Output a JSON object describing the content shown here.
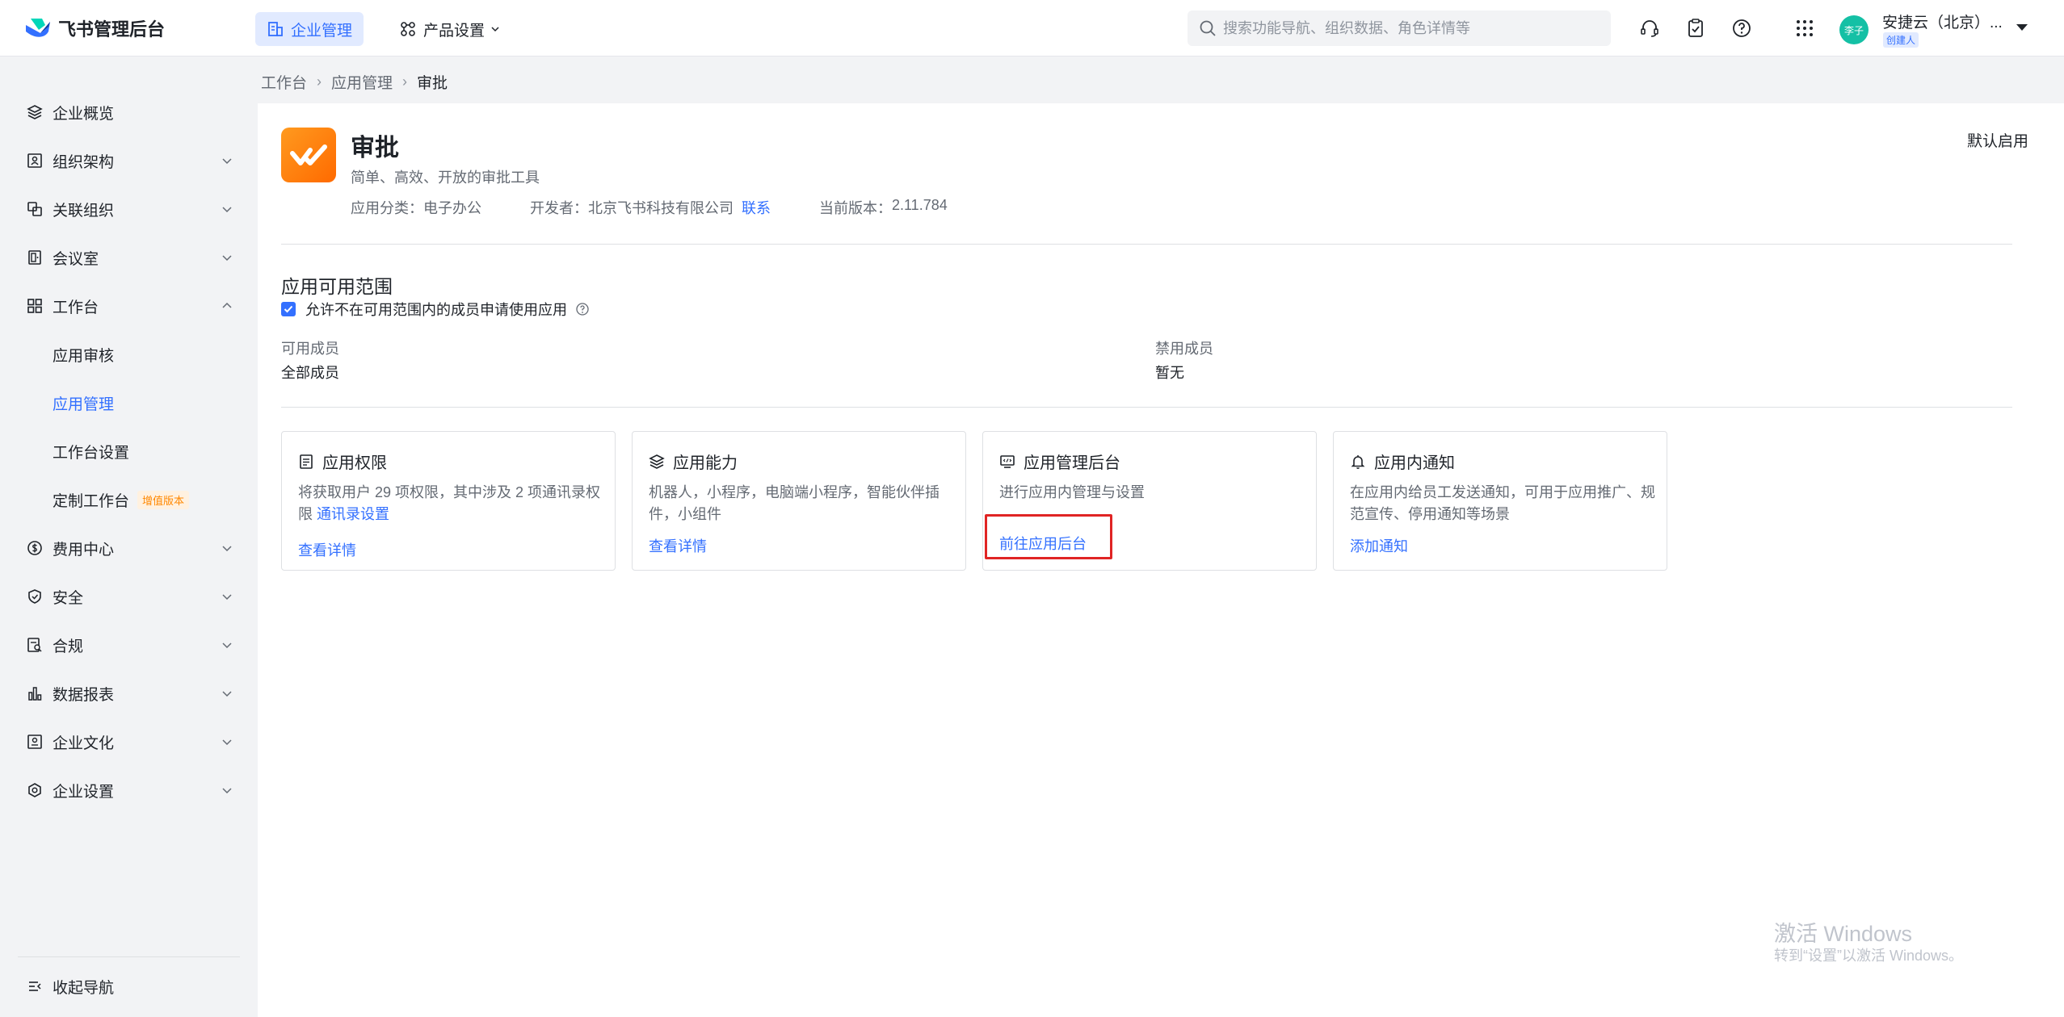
{
  "topbar": {
    "logo_text": "飞书管理后台",
    "nav": [
      {
        "label": "企业管理",
        "active": true
      },
      {
        "label": "产品设置",
        "active": false
      }
    ],
    "search_placeholder": "搜索功能导航、组织数据、角色详情等",
    "avatar_text": "李子",
    "org_name": "安捷云（北京）...",
    "org_role": "创建人"
  },
  "sidebar": {
    "items": [
      {
        "label": "企业概览",
        "icon": "layers-icon"
      },
      {
        "label": "组织架构",
        "icon": "org-icon"
      },
      {
        "label": "关联组织",
        "icon": "link-org-icon"
      },
      {
        "label": "会议室",
        "icon": "door-icon"
      },
      {
        "label": "工作台",
        "icon": "grid-icon"
      },
      {
        "label": "应用审核"
      },
      {
        "label": "应用管理"
      },
      {
        "label": "工作台设置"
      },
      {
        "label": "定制工作台",
        "tag": "增值版本"
      },
      {
        "label": "费用中心",
        "icon": "dollar-icon"
      },
      {
        "label": "安全",
        "icon": "shield-icon"
      },
      {
        "label": "合规",
        "icon": "compliance-icon"
      },
      {
        "label": "数据报表",
        "icon": "bar-chart-icon"
      },
      {
        "label": "企业文化",
        "icon": "culture-icon"
      },
      {
        "label": "企业设置",
        "icon": "settings-hex-icon"
      }
    ],
    "collapse_label": "收起导航"
  },
  "breadcrumb": [
    "工作台",
    "应用管理",
    "审批"
  ],
  "app": {
    "name": "审批",
    "description": "简单、高效、开放的审批工具",
    "category_label": "应用分类：",
    "category": "电子办公",
    "developer_label": "开发者：",
    "developer": "北京飞书科技有限公司",
    "contact_label": "联系",
    "version_label": "当前版本：",
    "version": "2.11.784",
    "status": "默认启用"
  },
  "scope": {
    "title": "应用可用范围",
    "allow_request_label": "允许不在可用范围内的成员申请使用应用",
    "allow_request_checked": true,
    "available_label": "可用成员",
    "available_value": "全部成员",
    "disabled_label": "禁用成员",
    "disabled_value": "暂无"
  },
  "cards": [
    {
      "title": "应用权限",
      "icon": "document-list-icon",
      "desc": "将获取用户 29 项权限，其中涉及 2 项通讯录权限",
      "desc_link": "通讯录设置",
      "link": "查看详情"
    },
    {
      "title": "应用能力",
      "icon": "layers-icon",
      "desc": "机器人，小程序，电脑端小程序，智能伙伴插件，小组件",
      "link": "查看详情"
    },
    {
      "title": "应用管理后台",
      "icon": "monitor-code-icon",
      "desc": "进行应用内管理与设置",
      "link": "前往应用后台"
    },
    {
      "title": "应用内通知",
      "icon": "bell-icon",
      "desc": "在应用内给员工发送通知，可用于应用推广、规范宣传、停用通知等场景",
      "link": "添加通知"
    }
  ],
  "watermark": {
    "line1": "激活 Windows",
    "line2": "转到“设置”以激活 Windows。"
  },
  "colors": {
    "accent": "#3370ff",
    "highlight": "#e02424",
    "app_icon": "#ff7a00"
  }
}
